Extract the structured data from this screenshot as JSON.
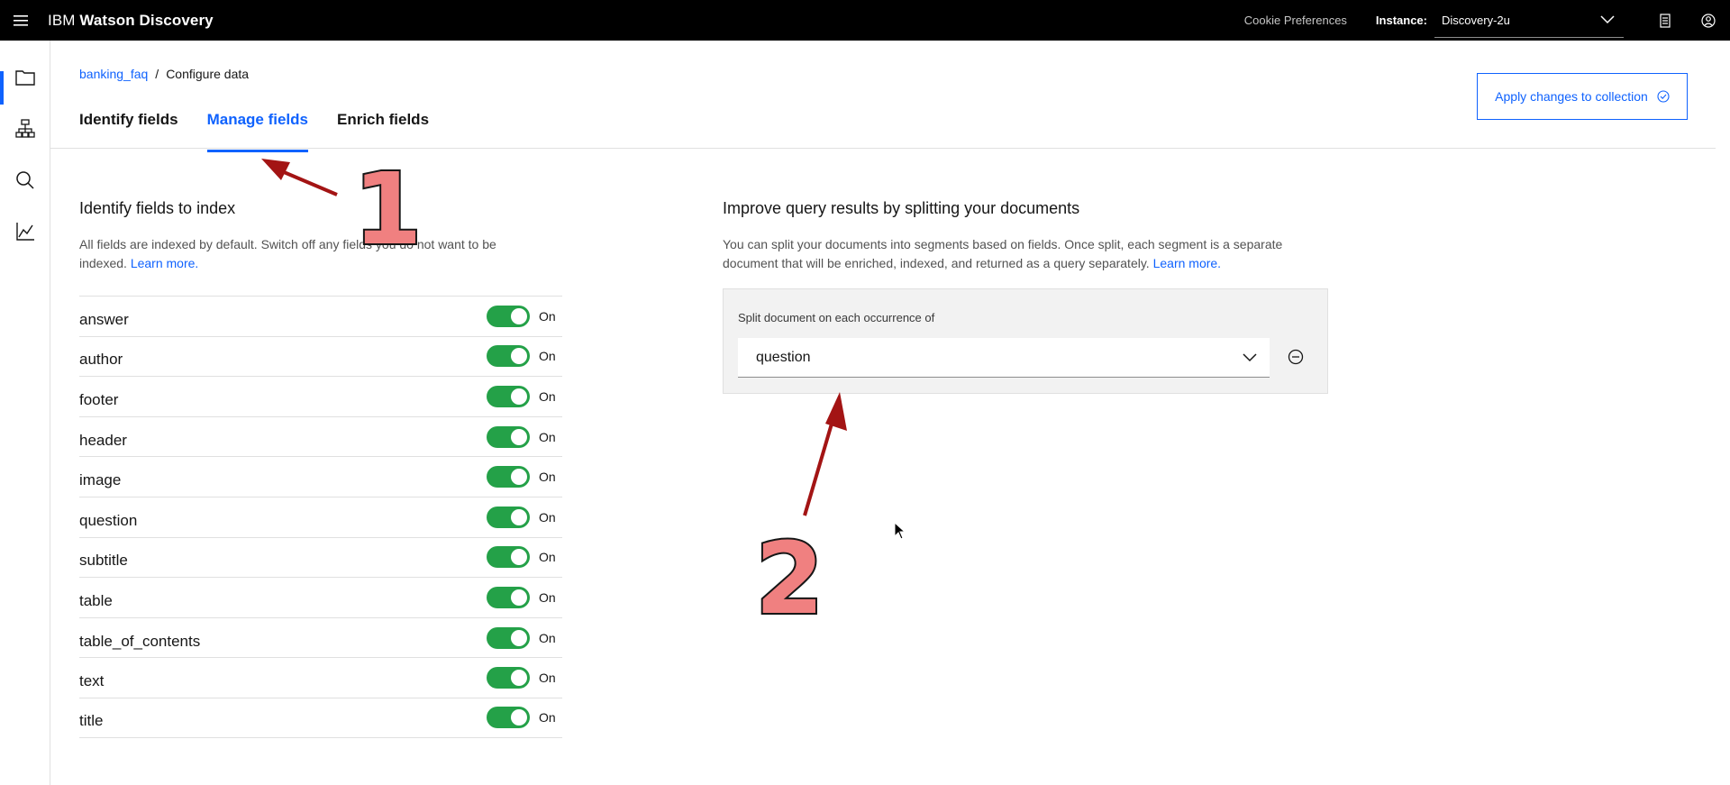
{
  "topbar": {
    "brand_prefix": "IBM",
    "brand_name": "Watson Discovery",
    "cookie_label": "Cookie Preferences",
    "instance_label": "Instance:",
    "instance_value": "Discovery-2u"
  },
  "sidenav": {
    "items": [
      {
        "name": "folder-icon",
        "active": true
      },
      {
        "name": "hierarchy-icon",
        "active": false
      },
      {
        "name": "search-icon",
        "active": false
      },
      {
        "name": "chart-icon",
        "active": false
      }
    ]
  },
  "breadcrumb": {
    "collection": "banking_faq",
    "separator": "/",
    "current": "Configure data"
  },
  "tabs": [
    {
      "label": "Identify fields",
      "active": false
    },
    {
      "label": "Manage fields",
      "active": true
    },
    {
      "label": "Enrich fields",
      "active": false
    }
  ],
  "apply_button": {
    "label": "Apply changes to collection"
  },
  "index_section": {
    "title": "Identify fields to index",
    "description": "All fields are indexed by default. Switch off any fields you do not want to be indexed.",
    "learn_more": "Learn more.",
    "fields": [
      {
        "name": "answer",
        "state": "On"
      },
      {
        "name": "author",
        "state": "On"
      },
      {
        "name": "footer",
        "state": "On"
      },
      {
        "name": "header",
        "state": "On"
      },
      {
        "name": "image",
        "state": "On"
      },
      {
        "name": "question",
        "state": "On"
      },
      {
        "name": "subtitle",
        "state": "On"
      },
      {
        "name": "table",
        "state": "On"
      },
      {
        "name": "table_of_contents",
        "state": "On"
      },
      {
        "name": "text",
        "state": "On"
      },
      {
        "name": "title",
        "state": "On"
      }
    ]
  },
  "split_section": {
    "title": "Improve query results by splitting your documents",
    "description": "You can split your documents into segments based on fields. Once split, each segment is a separate document that will be enriched, indexed, and returned as a query separately.",
    "learn_more": "Learn more.",
    "select_label": "Split document on each occurrence of",
    "select_value": "question"
  },
  "annotations": {
    "one": "1",
    "two": "2",
    "color": "#b31b1b",
    "number_fill": "#f08080"
  }
}
